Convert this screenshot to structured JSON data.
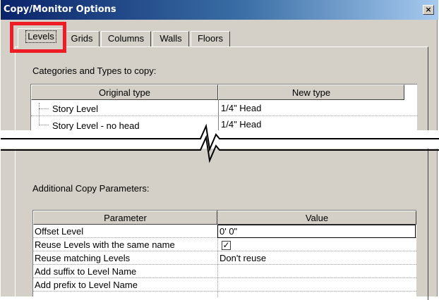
{
  "window": {
    "title": "Copy/Monitor Options",
    "close_label": "×"
  },
  "tabs": [
    {
      "label": "Levels",
      "active": true
    },
    {
      "label": "Grids"
    },
    {
      "label": "Columns"
    },
    {
      "label": "Walls"
    },
    {
      "label": "Floors"
    }
  ],
  "categories_section": {
    "label": "Categories and Types to copy:",
    "columns": [
      "Original type",
      "New type"
    ],
    "rows": [
      {
        "original": "Story Level",
        "new": "1/4\" Head"
      },
      {
        "original": "Story Level - no head",
        "new": "1/4\" Head"
      }
    ]
  },
  "additional_section": {
    "label": "Additional Copy Parameters:",
    "columns": [
      "Parameter",
      "Value"
    ],
    "rows": [
      {
        "parameter": "Offset Level",
        "value": "0'  0\""
      },
      {
        "parameter": "Reuse Levels with the same name",
        "checked": true
      },
      {
        "parameter": "Reuse matching Levels",
        "value": "Don't reuse"
      },
      {
        "parameter": "Add suffix to Level Name",
        "value": ""
      },
      {
        "parameter": "Add prefix to Level Name",
        "value": ""
      }
    ]
  },
  "colors": {
    "highlight": "#ee1c24",
    "title_bar": "#0a246a",
    "dialog_bg": "#d4d0c8"
  }
}
